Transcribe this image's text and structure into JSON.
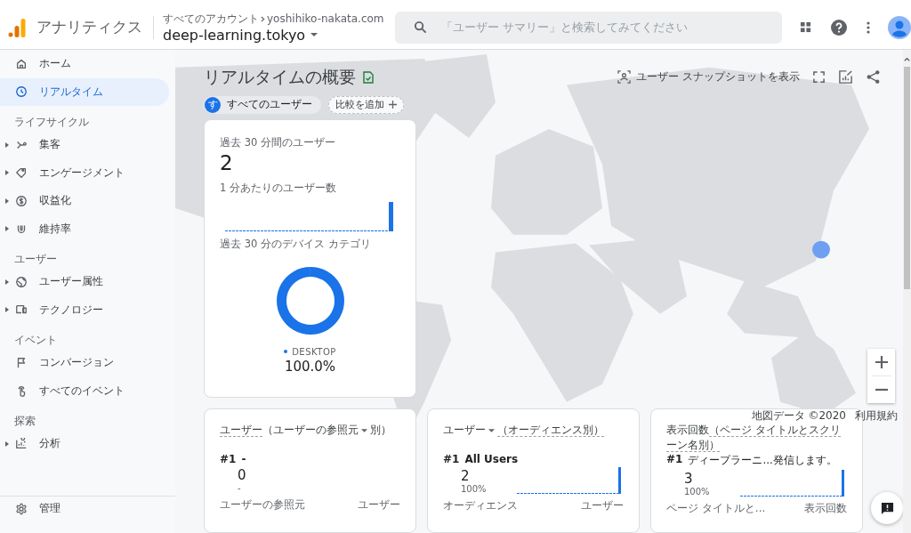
{
  "header": {
    "app_name": "アナリティクス",
    "breadcrumb": [
      "すべてのアカウント",
      "yoshihiko-nakata.com"
    ],
    "property": "deep-learning.tokyo",
    "search": {
      "placeholder": "「ユーザー サマリー」と検索してみてください"
    }
  },
  "sidebar": {
    "items": [
      {
        "kind": "link",
        "label": "ホーム",
        "selected": false
      },
      {
        "kind": "link",
        "label": "リアルタイム",
        "selected": true
      },
      {
        "kind": "heading",
        "label": "ライフサイクル"
      },
      {
        "kind": "group",
        "label": "集客",
        "selected": false
      },
      {
        "kind": "group",
        "label": "エンゲージメント",
        "selected": false
      },
      {
        "kind": "group",
        "label": "収益化",
        "selected": false
      },
      {
        "kind": "group",
        "label": "維持率",
        "selected": false
      },
      {
        "kind": "heading",
        "label": "ユーザー"
      },
      {
        "kind": "group",
        "label": "ユーザー属性",
        "selected": false
      },
      {
        "kind": "group",
        "label": "テクノロジー",
        "selected": false
      },
      {
        "kind": "heading",
        "label": "イベント"
      },
      {
        "kind": "link",
        "label": "コンバージョン",
        "selected": false
      },
      {
        "kind": "link",
        "label": "すべてのイベント",
        "selected": false
      },
      {
        "kind": "heading",
        "label": "探索"
      },
      {
        "kind": "group",
        "label": "分析",
        "selected": false
      }
    ],
    "footer": {
      "label": "管理",
      "selected": false
    }
  },
  "page": {
    "title": "リアルタイムの概要",
    "snapshot_button": "ユーザー スナップショットを表示",
    "segments": [
      {
        "initial": "す",
        "label": "すべてのユーザー"
      }
    ],
    "compare_button": "比較を追加"
  },
  "summary_card": {
    "users_label": "過去 30 分間のユーザー",
    "users_value": "2",
    "per_minute_label": "1 分あたりのユーザー数",
    "device_label": "過去 30 分のデバイス カテゴリ",
    "legend": [
      {
        "label": "DESKTOP",
        "value": "100.0%",
        "color": "#1a73e8"
      }
    ]
  },
  "cards": [
    {
      "title": [
        {
          "text": "ユーザー",
          "underlined": true,
          "dropdown": false
        },
        {
          "text": "（ユーザーの参照元",
          "underlined": false,
          "dropdown": true
        },
        {
          "text": "別）",
          "underlined": false,
          "dropdown": false
        }
      ],
      "rank": "#1",
      "top": "-",
      "value": "0",
      "share": "-",
      "sparkline": false,
      "columns": [
        "ユーザーの参照元",
        "ユーザー"
      ]
    },
    {
      "title": [
        {
          "text": "ユーザー",
          "underlined": false,
          "dropdown": true
        },
        {
          "text": "（オーディエンス別）",
          "underlined": true,
          "dropdown": false
        }
      ],
      "rank": "#1",
      "top": "All Users",
      "value": "2",
      "share": "100%",
      "sparkline": true,
      "columns": [
        "オーディエンス",
        "ユーザー"
      ]
    },
    {
      "title": [
        {
          "text": "表示回数",
          "underlined": false,
          "dropdown": false
        },
        {
          "text": "（ページ タイトルとスクリーン名別）",
          "underlined": true,
          "dropdown": false
        }
      ],
      "rank": "#1",
      "top": "ディープラーニ...発信します。",
      "value": "3",
      "share": "100%",
      "sparkline": true,
      "columns": [
        "ページ タイトルと...",
        "表示回数"
      ]
    }
  ],
  "map": {
    "attribution": "地図データ ©2020",
    "terms": "利用規約"
  }
}
